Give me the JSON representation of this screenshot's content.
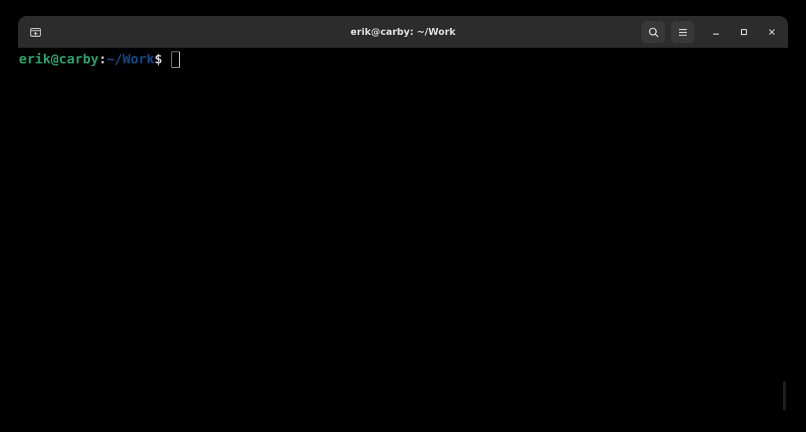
{
  "window": {
    "title": "erik@carby: ~/Work"
  },
  "header": {
    "new_tab_icon": "new-tab-icon",
    "search_icon": "search-icon",
    "menu_icon": "hamburger-menu-icon",
    "minimize_icon": "minimize-icon",
    "maximize_icon": "maximize-icon",
    "close_icon": "close-icon"
  },
  "terminal": {
    "prompt_user_host": "erik@carby",
    "prompt_colon": ":",
    "prompt_cwd": "~/Work",
    "prompt_symbol": "$",
    "input_text": ""
  },
  "colors": {
    "user_host": "#26a269",
    "cwd": "#12488b",
    "titlebar_bg": "#2c2c2c",
    "terminal_bg": "#000000"
  }
}
